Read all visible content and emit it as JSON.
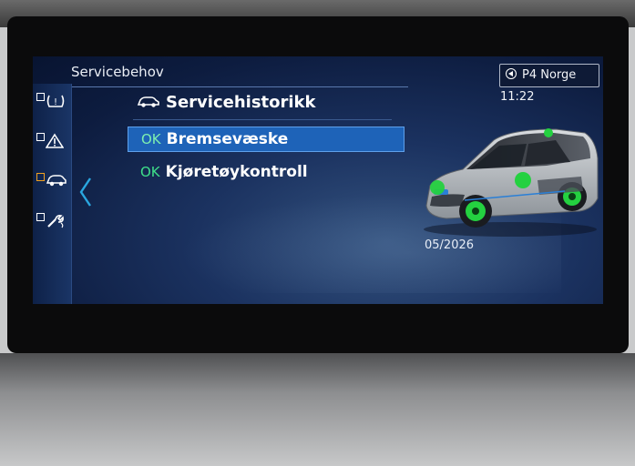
{
  "screen": {
    "title": "Servicebehov",
    "status": {
      "station": "P4 Norge",
      "time": "11:22"
    },
    "menu_header": "Servicehistorikk",
    "items": [
      {
        "status": "OK",
        "label": "Bremsevæske",
        "selected": true
      },
      {
        "status": "OK",
        "label": "Kjøretøykontroll",
        "selected": false
      }
    ],
    "date": "05/2026"
  },
  "left_rail": [
    {
      "icon": "tire-pressure-warning-icon",
      "glyph": "(!)"
    },
    {
      "icon": "warning-triangle-icon",
      "glyph": "⚠"
    },
    {
      "icon": "car-service-icon",
      "glyph": "🚗"
    },
    {
      "icon": "wrench-service-icon",
      "glyph": "🔧"
    }
  ],
  "colors": {
    "selected_row": "#1e63b8",
    "ok_green": "#3fe08a",
    "accent": "#2aa7e0"
  }
}
